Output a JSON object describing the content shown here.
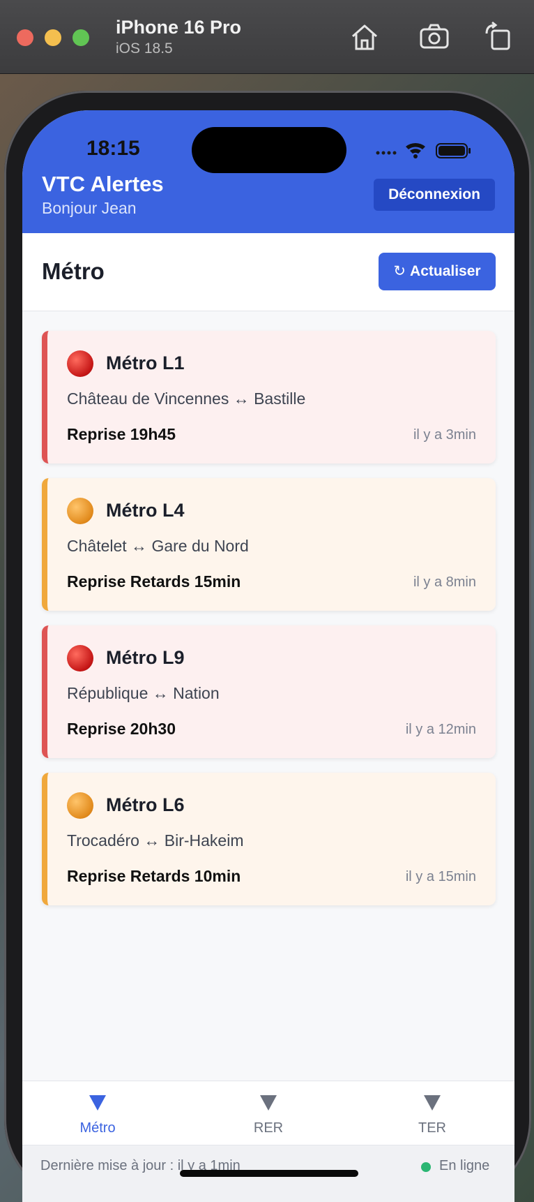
{
  "simulator": {
    "device_name": "iPhone 16 Pro",
    "os_version": "iOS 18.5",
    "toolbar_icons": [
      "home-icon",
      "camera-icon",
      "rotate-icon"
    ]
  },
  "status_bar": {
    "time": "18:15"
  },
  "header": {
    "title": "VTC Alertes",
    "greeting": "Bonjour Jean",
    "logout_label": "Déconnexion",
    "brand_color": "#3b63e0"
  },
  "section": {
    "title": "Métro",
    "refresh_icon": "↻",
    "refresh_label": "Actualiser"
  },
  "alerts": [
    {
      "line": "Métro L1",
      "route": "Château de Vincennes ↔ Bastille",
      "status": "Reprise 19h45",
      "time": "il y a 3min",
      "severity": "red",
      "color": "#de5454"
    },
    {
      "line": "Métro L4",
      "route": "Châtelet ↔ Gare du Nord",
      "status": "Reprise Retards 15min",
      "time": "il y a 8min",
      "severity": "orange",
      "color": "#f0a83c"
    },
    {
      "line": "Métro L9",
      "route": "République ↔ Nation",
      "status": "Reprise 20h30",
      "time": "il y a 12min",
      "severity": "red",
      "color": "#de5454"
    },
    {
      "line": "Métro L6",
      "route": "Trocadéro ↔ Bir-Hakeim",
      "status": "Reprise Retards 10min",
      "time": "il y a 15min",
      "severity": "orange",
      "color": "#f0a83c"
    }
  ],
  "tabs": [
    {
      "label": "Métro",
      "active": true
    },
    {
      "label": "RER",
      "active": false
    },
    {
      "label": "TER",
      "active": false
    }
  ],
  "footer": {
    "last_update": "Dernière mise à jour : il y a 1min",
    "connection": "En ligne"
  }
}
